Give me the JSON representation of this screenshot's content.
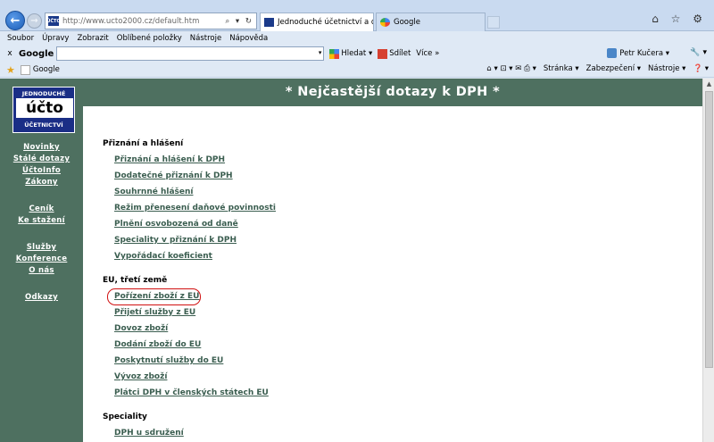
{
  "browser": {
    "address_url": "http://www.ucto2000.cz/default.htm",
    "address_icons": "⌕ ▾ ↻",
    "favicon_text": "ÚČTO",
    "tabs": [
      {
        "label": "Jednoduché účetnictví a da...",
        "close": "✕",
        "active": true
      },
      {
        "label": "Google",
        "close": "",
        "active": false
      }
    ],
    "window_icons": "⌂ ☆ ⚙"
  },
  "menu": [
    "Soubor",
    "Úpravy",
    "Zobrazit",
    "Oblíbené položky",
    "Nástroje",
    "Nápověda"
  ],
  "toolbar": {
    "close": "x",
    "google_label": "Google",
    "search_dropdown": "▾",
    "search_button": "Hledat ▾",
    "share_button": "Sdílet",
    "more_button": "Více »",
    "user": "Petr Kučera ▾",
    "wrench": "🔧 ▾"
  },
  "favorites": {
    "star": "★",
    "google_link": "Google"
  },
  "commandbar": {
    "icons": "⌂ ▾  ⊡ ▾  ✉  ⎙ ▾",
    "page": "Stránka ▾",
    "security": "Zabezpečení ▾",
    "tools": "Nástroje ▾",
    "help": "❓ ▾"
  },
  "site": {
    "logo": {
      "line1": "JEDNODUCHÉ",
      "line2": "účto",
      "line3": "ÚČETNICTVÍ"
    },
    "nav": [
      "Novinky",
      "Stálé dotazy",
      "ÚčtoInfo",
      "Zákony",
      "Ceník",
      "Ke stažení",
      "Služby",
      "Konference",
      "O nás",
      "Odkazy"
    ],
    "header": "* Nejčastější dotazy k DPH *",
    "sections": [
      {
        "title": "Přiznání a hlášení",
        "items": [
          "Přiznání a hlášení k DPH",
          "Dodatečné přiznání k DPH",
          "Souhrnné hlášení",
          "Režim přenesení daňové povinnosti",
          "Plnění osvobozená od daně",
          "Speciality v přiznání k DPH",
          "Vypořádací koeficient"
        ]
      },
      {
        "title": "EU, třetí země",
        "items": [
          "Pořízení zboží z EU",
          "Přijetí služby z EU",
          "Dovoz zboží",
          "Dodání zboží do EU",
          "Poskytnutí služby do EU",
          "Vývoz zboží",
          "Plátci DPH v členských státech EU"
        ]
      },
      {
        "title": "Speciality",
        "items": [
          "DPH u sdružení"
        ]
      }
    ]
  },
  "scrollbar": {
    "up_arrow": "▲"
  }
}
